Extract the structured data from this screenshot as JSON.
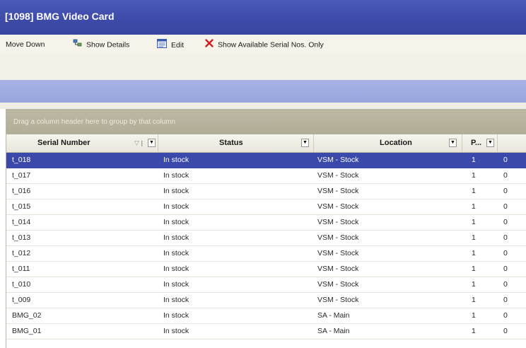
{
  "window": {
    "title": "[1098] BMG Video Card"
  },
  "toolbar": {
    "move_down": "Move Down",
    "show_details": "Show Details",
    "edit": "Edit",
    "show_available": "Show Available Serial Nos. Only"
  },
  "grid": {
    "group_hint": "Drag a column header here to group by that column",
    "columns": {
      "serial": "Serial Number",
      "status": "Status",
      "location": "Location",
      "p": "P..."
    },
    "rows": [
      {
        "serial": "t_018",
        "status": "In stock",
        "location": "VSM - Stock",
        "p": "1",
        "extra": "0"
      },
      {
        "serial": "t_017",
        "status": "In stock",
        "location": "VSM - Stock",
        "p": "1",
        "extra": "0"
      },
      {
        "serial": "t_016",
        "status": "In stock",
        "location": "VSM - Stock",
        "p": "1",
        "extra": "0"
      },
      {
        "serial": "t_015",
        "status": "In stock",
        "location": "VSM - Stock",
        "p": "1",
        "extra": "0"
      },
      {
        "serial": "t_014",
        "status": "In stock",
        "location": "VSM - Stock",
        "p": "1",
        "extra": "0"
      },
      {
        "serial": "t_013",
        "status": "In stock",
        "location": "VSM - Stock",
        "p": "1",
        "extra": "0"
      },
      {
        "serial": "t_012",
        "status": "In stock",
        "location": "VSM - Stock",
        "p": "1",
        "extra": "0"
      },
      {
        "serial": "t_011",
        "status": "In stock",
        "location": "VSM - Stock",
        "p": "1",
        "extra": "0"
      },
      {
        "serial": "t_010",
        "status": "In stock",
        "location": "VSM - Stock",
        "p": "1",
        "extra": "0"
      },
      {
        "serial": "t_009",
        "status": "In stock",
        "location": "VSM - Stock",
        "p": "1",
        "extra": "0"
      },
      {
        "serial": "BMG_02",
        "status": "In stock",
        "location": "SA - Main",
        "p": "1",
        "extra": "0"
      },
      {
        "serial": "BMG_01",
        "status": "In stock",
        "location": "SA - Main",
        "p": "1",
        "extra": "0"
      }
    ]
  },
  "icons": {
    "show_details": "details-icon",
    "edit": "edit-icon",
    "show_available": "red-x-icon",
    "filter": "dropdown-filter-icon"
  },
  "colors": {
    "title_bar": "#3d4aa8",
    "selected_row": "#3b49ab",
    "group_panel": "#b8b39d",
    "red_x": "#d31f1f"
  }
}
